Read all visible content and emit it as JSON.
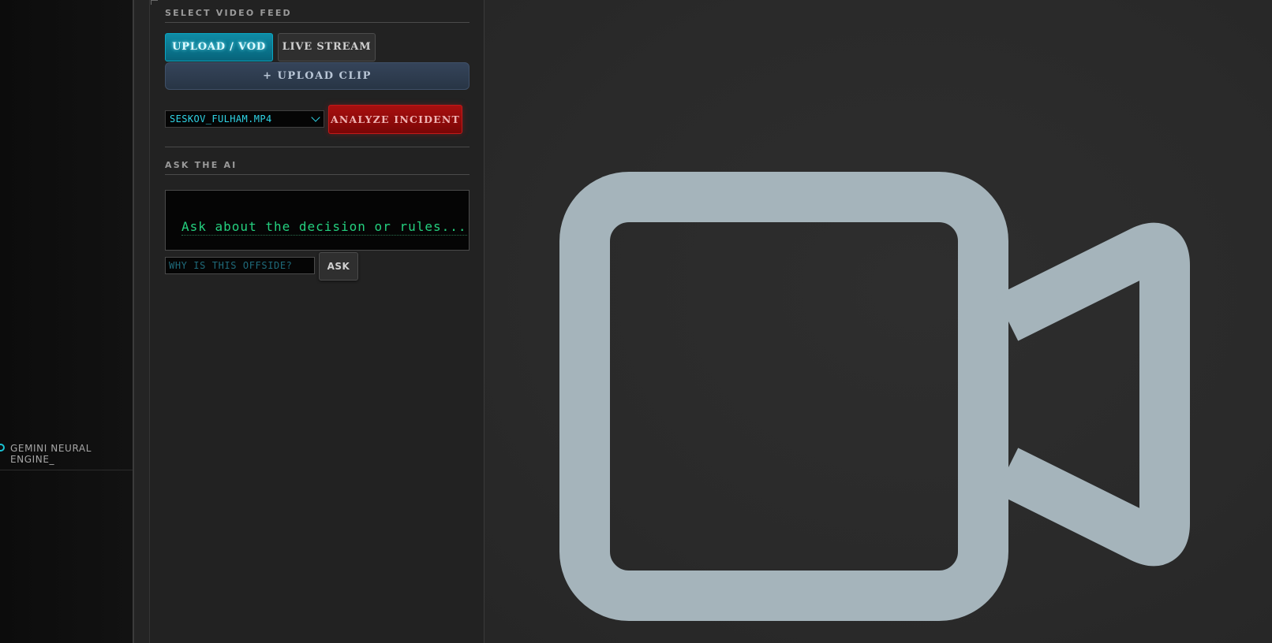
{
  "sidebar": {
    "engine_label": "GEMINI NEURAL ENGINE_"
  },
  "feed": {
    "section_title": "SELECT VIDEO FEED",
    "upload_vod_label": "UPLOAD / VOD",
    "live_stream_label": "LIVE STREAM",
    "upload_clip_label": "+ UPLOAD CLIP",
    "selected_file": "SESKOV_FULHAM.MP4",
    "analyze_label": "ANALYZE INCIDENT"
  },
  "ask": {
    "section_title": "ASK THE AI",
    "response_placeholder": "Ask about the decision or rules...",
    "input_placeholder": "WHY IS THIS OFFSIDE?",
    "ask_label": "ASK"
  },
  "video": {
    "icon": "video-camera-icon",
    "icon_color": "#a5b4bb"
  },
  "colors": {
    "accent_cyan": "#0f8ca6",
    "danger_red": "#a80f0f",
    "terminal_green": "#24d07f"
  }
}
